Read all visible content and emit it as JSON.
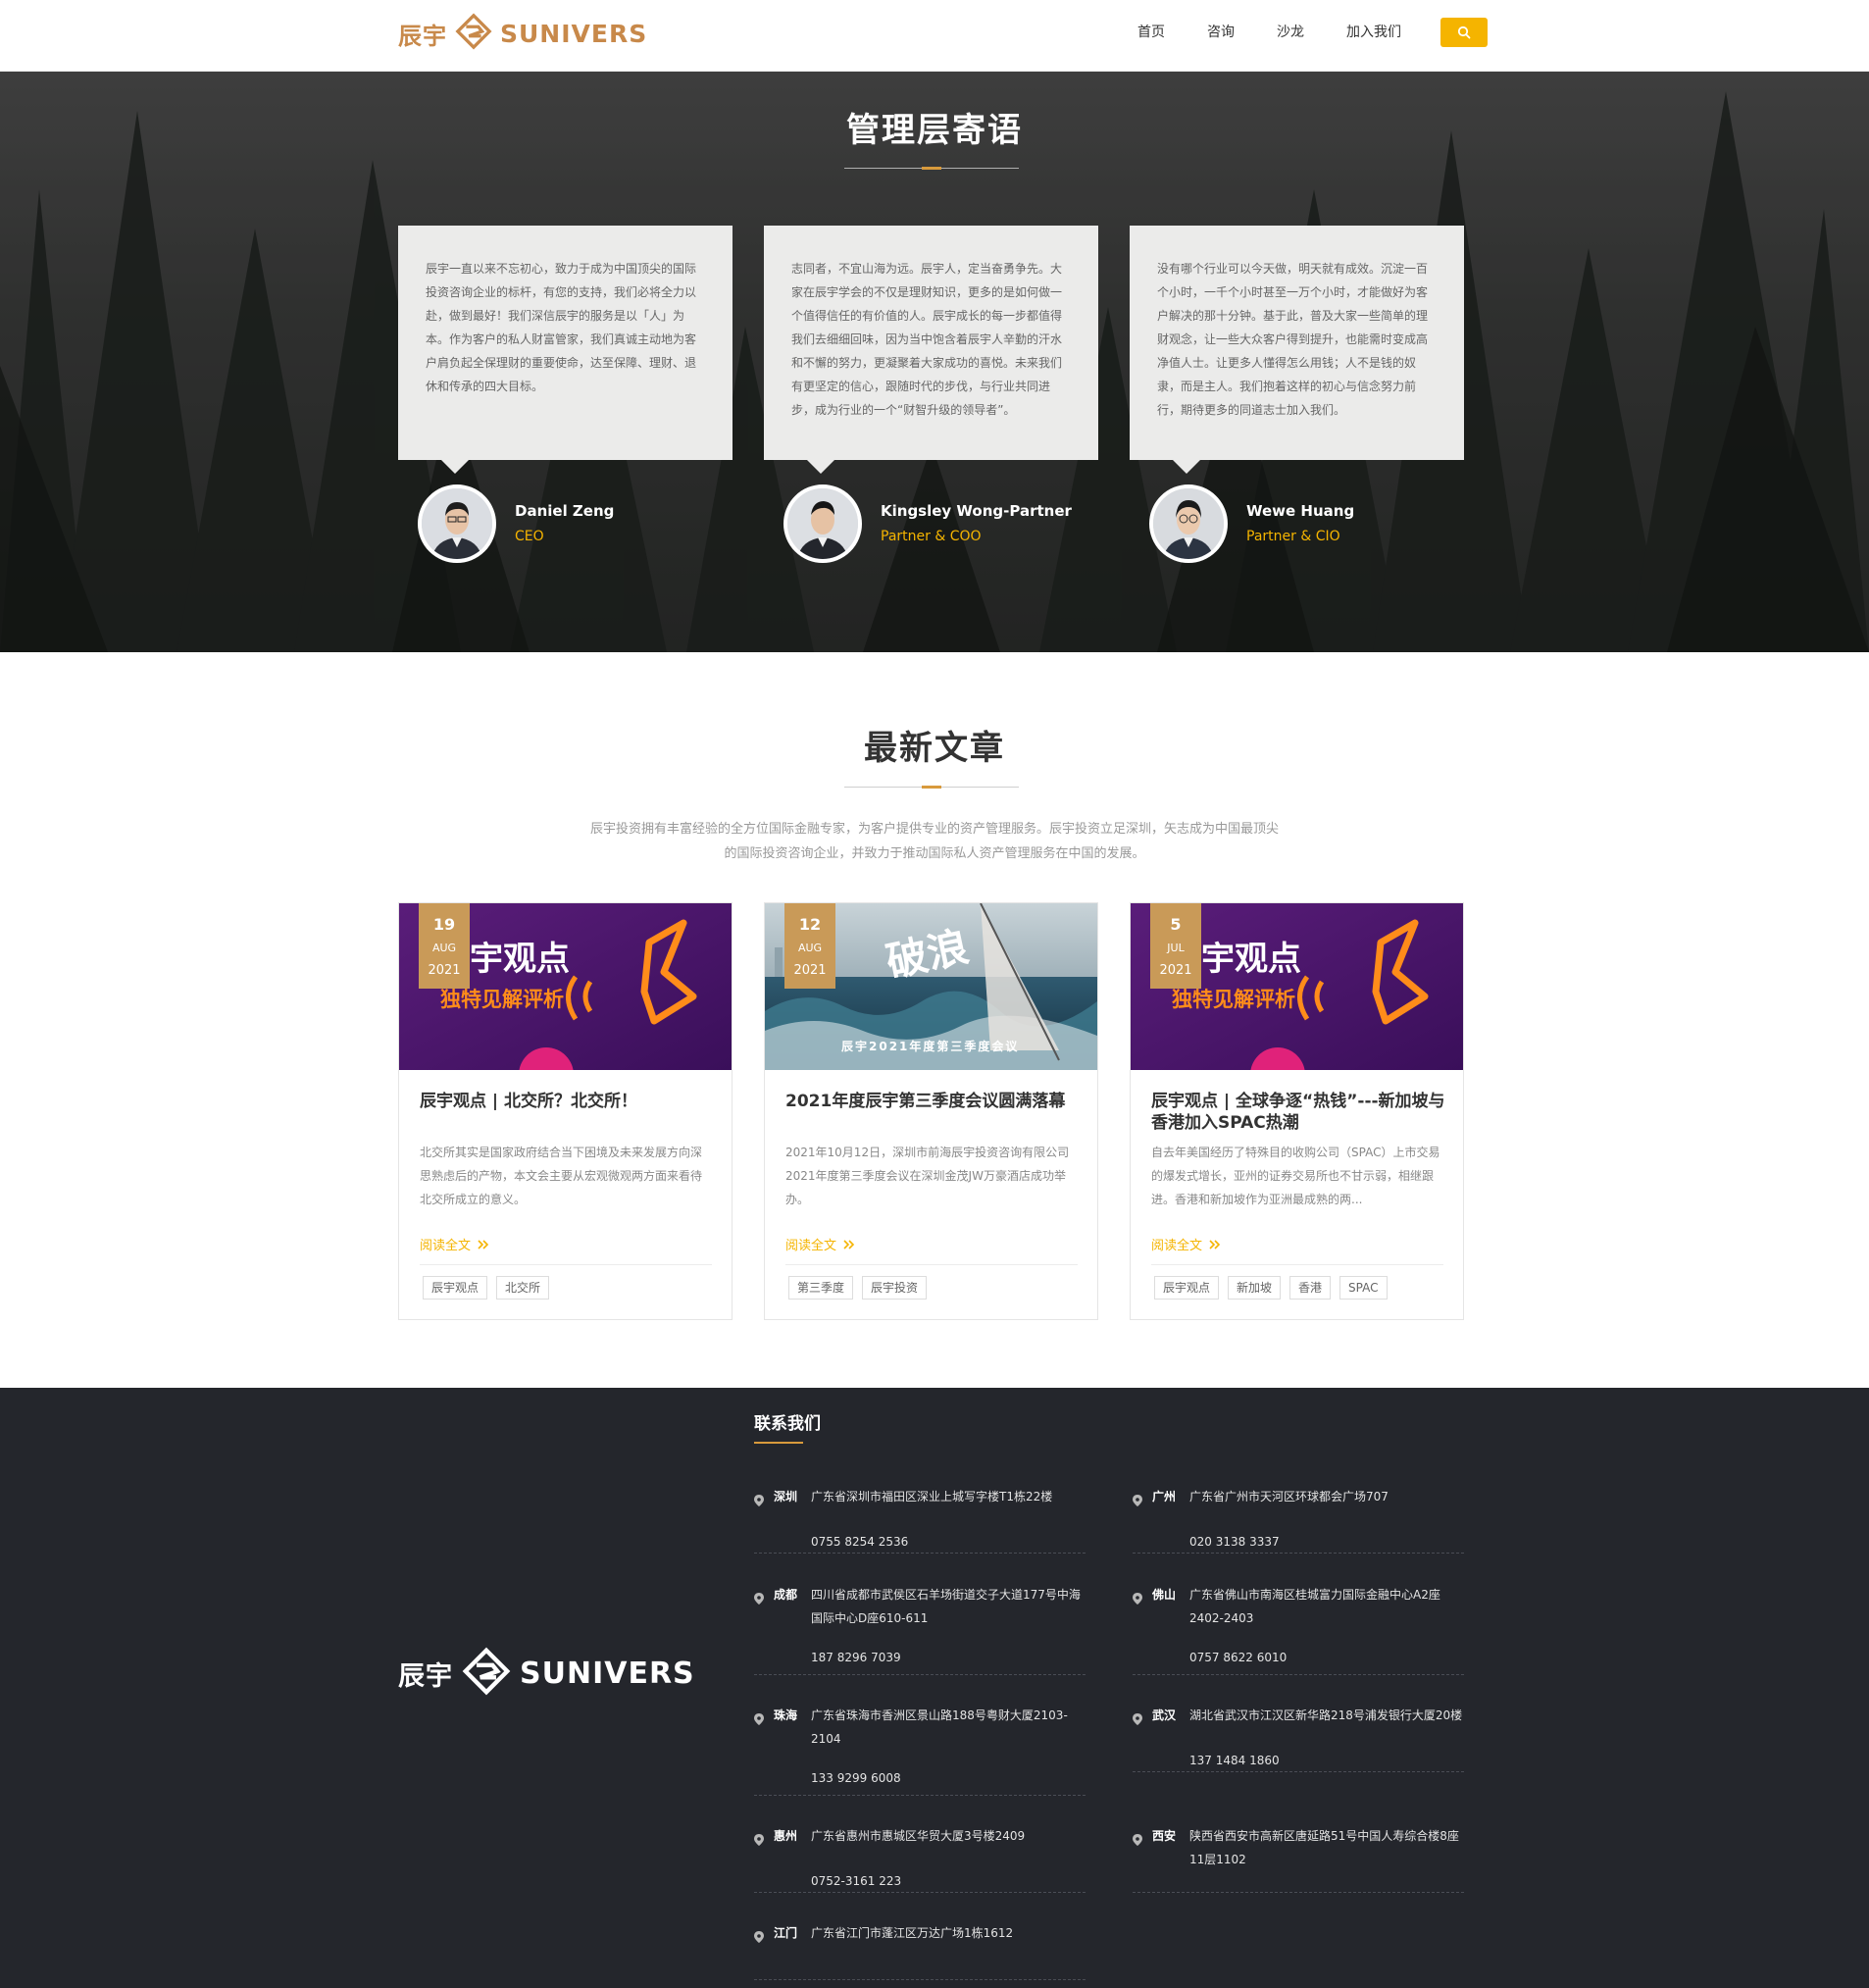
{
  "header": {
    "logo_cn": "辰宇",
    "logo_en": "SUNIVERS",
    "nav": [
      "首页",
      "咨询",
      "沙龙",
      "加入我们"
    ]
  },
  "hero": {
    "title": "管理层寄语",
    "quotes": [
      "辰宇一直以来不忘初心，致力于成为中国顶尖的国际投资咨询企业的标杆，有您的支持，我们必将全力以赴，做到最好！我们深信辰宇的服务是以「人」为本。作为客户的私人财富管家，我们真诚主动地为客户肩负起全保理财的重要使命，达至保障、理财、退休和传承的四大目标。",
      "志同者，不宜山海为远。辰宇人，定当奋勇争先。大家在辰宇学会的不仅是理财知识，更多的是如何做一个值得信任的有价值的人。辰宇成长的每一步都值得我们去细细回味，因为当中饱含着辰宇人辛勤的汗水和不懈的努力，更凝聚着大家成功的喜悦。未来我们有更坚定的信心，跟随时代的步伐，与行业共同进步，成为行业的一个“财智升级的领导者”。",
      "没有哪个行业可以今天做，明天就有成效。沉淀一百个小时，一千个小时甚至一万个小时，才能做好为客户解决的那十分钟。基于此，普及大家一些简单的理财观念，让一些大众客户得到提升，也能需时变成高净值人士。让更多人懂得怎么用钱；人不是钱的奴隶，而是主人。我们抱着这样的初心与信念努力前行，期待更多的同道志士加入我们。"
    ],
    "people": [
      {
        "name": "Daniel Zeng",
        "role": "CEO"
      },
      {
        "name": "Kingsley Wong-Partner",
        "role": "Partner & COO"
      },
      {
        "name": "Wewe Huang",
        "role": "Partner & CIO"
      }
    ]
  },
  "articles": {
    "title": "最新文章",
    "description": "辰宇投资拥有丰富经验的全方位国际金融专家，为客户提供专业的资产管理服务。辰宇投资立足深圳，矢志成为中国最顶尖的国际投资咨询企业，并致力于推动国际私人资产管理服务在中国的发展。",
    "read_more": "阅读全文",
    "items": [
      {
        "day": "19",
        "month": "AUG",
        "year": "2021",
        "img_text_1": "宇观点",
        "img_text_2": "独特见解评析",
        "title": "辰宇观点 | 北交所？北交所！",
        "excerpt": "北交所其实是国家政府结合当下困境及未来发展方向深思熟虑后的产物，本文会主要从宏观微观两方面来看待北交所成立的意义。",
        "tags": [
          "辰宇观点",
          "北交所"
        ]
      },
      {
        "day": "12",
        "month": "AUG",
        "year": "2021",
        "img_text_1": "破浪",
        "img_text_2": "辰宇2021年度第三季度会议",
        "title": "2021年度辰宇第三季度会议圆满落幕",
        "excerpt": "2021年10月12日，深圳市前海辰宇投资咨询有限公司2021年度第三季度会议在深圳金茂JW万豪酒店成功举办。",
        "tags": [
          "第三季度",
          "辰宇投资"
        ]
      },
      {
        "day": "5",
        "month": "JUL",
        "year": "2021",
        "img_text_1": "宇观点",
        "img_text_2": "独特见解评析",
        "title": "辰宇观点 | 全球争逐“热钱”---新加坡与香港加入SPAC热潮",
        "excerpt": "自去年美国经历了特殊目的收购公司（SPAC）上市交易的爆发式增长，亚州的证券交易所也不甘示弱，相继跟进。香港和新加坡作为亚洲最成熟的两...",
        "tags": [
          "辰宇观点",
          "新加坡",
          "香港",
          "SPAC"
        ]
      }
    ]
  },
  "footer": {
    "logo_cn": "辰宇",
    "logo_en": "SUNIVERS",
    "contact_title": "联系我们",
    "offices": [
      {
        "city": "深圳",
        "address": "广东省深圳市福田区深业上城写字楼T1栋22楼",
        "phone": "0755 8254 2536"
      },
      {
        "city": "广州",
        "address": "广东省广州市天河区环球都会广场707",
        "phone": "020 3138 3337"
      },
      {
        "city": "成都",
        "address": "四川省成都市武侯区石羊场街道交子大道177号中海国际中心D座610-611",
        "phone": "187 8296 7039"
      },
      {
        "city": "佛山",
        "address": "广东省佛山市南海区桂城富力国际金融中心A2座2402-2403",
        "phone": "0757 8622 6010"
      },
      {
        "city": "珠海",
        "address": "广东省珠海市香洲区景山路188号粤财大厦2103-2104",
        "phone": "133 9299 6008"
      },
      {
        "city": "武汉",
        "address": "湖北省武汉市江汉区新华路218号浦发银行大厦20楼",
        "phone": "137 1484 1860"
      },
      {
        "city": "惠州",
        "address": "广东省惠州市惠城区华贸大厦3号楼2409",
        "phone": "0752-3161 223"
      },
      {
        "city": "西安",
        "address": "陕西省西安市高新区唐延路51号中国人寿综合楼8座11层1102",
        "phone": ""
      },
      {
        "city": "江门",
        "address": "广东省江门市蓬江区万达广场1栋1612",
        "phone": ""
      }
    ]
  },
  "colors": {
    "brand_gold": "#c8894a",
    "accent_yellow": "#f5b400",
    "footer_bg": "#24262c",
    "date_badge": "#c99a58"
  },
  "icons": [
    "search-icon",
    "pin-icon",
    "double-chevron-right-icon",
    "sunivers-logo-icon"
  ]
}
